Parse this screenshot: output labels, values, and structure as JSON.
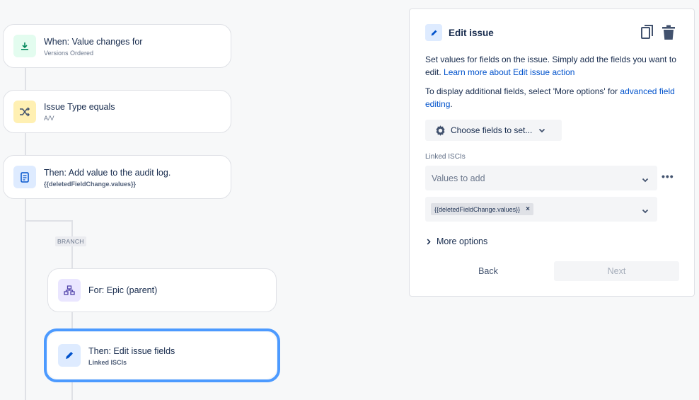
{
  "flow": {
    "trigger": {
      "title": "When: Value changes for",
      "sub": "Versions Ordered"
    },
    "condition": {
      "title": "Issue Type equals",
      "sub": "A/V"
    },
    "audit": {
      "title": "Then: Add value to the audit log.",
      "sub": "{{deletedFieldChange.values}}"
    },
    "branch_label": "BRANCH",
    "for_parent": {
      "title": "For: Epic (parent)"
    },
    "edit_fields": {
      "title": "Then: Edit issue fields",
      "sub": "Linked ISCIs"
    }
  },
  "panel": {
    "title": "Edit issue",
    "desc_1": "Set values for fields on the issue. Simply add the fields you want to edit. ",
    "desc_1_link": "Learn more about Edit issue action",
    "desc_2": "To display additional fields, select 'More options' for ",
    "desc_2_link": "advanced field editing",
    "desc_2_end": ".",
    "choose_fields": "Choose fields to set...",
    "field_label": "Linked ISCIs",
    "select_placeholder": "Values to add",
    "tag_value": "{{deletedFieldChange.values}}",
    "tag_remove": "×",
    "more_options": "More options",
    "back": "Back",
    "next": "Next"
  },
  "colors": {
    "accent": "#0052cc",
    "selection": "#4c9aff"
  }
}
